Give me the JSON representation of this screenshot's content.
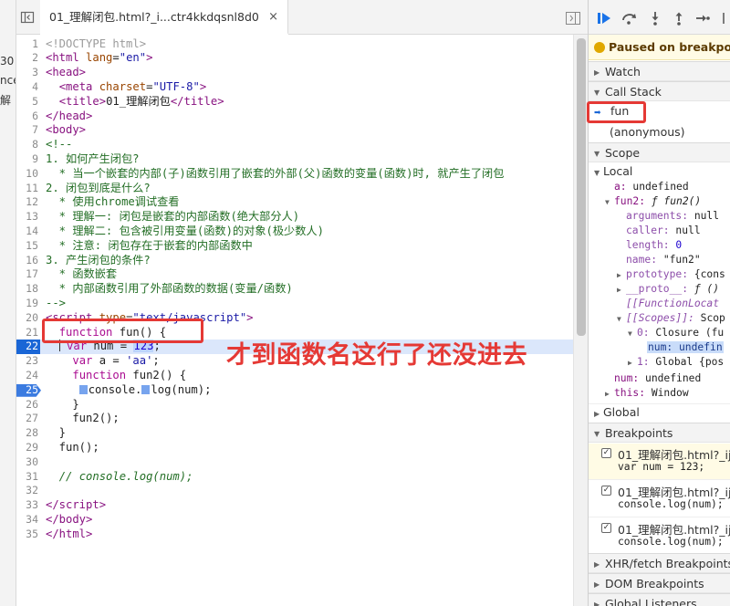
{
  "left_panel": {
    "fragments": [
      "30",
      "nce",
      "解"
    ]
  },
  "editor": {
    "tab_label": "01_理解闭包.html?_i...ctr4kkdqsnl8d0",
    "tab_close": "×",
    "annotation_text": "才到函数名这行了还没进去"
  },
  "code_lines": [
    {
      "n": "1",
      "html": "<span class='gray'>&lt;!DOCTYPE html&gt;</span>"
    },
    {
      "n": "2",
      "html": "<span class='tag'>&lt;html</span> <span class='attr'>lang</span>=<span class='str'>\"en\"</span><span class='tag'>&gt;</span>"
    },
    {
      "n": "3",
      "html": "<span class='tag'>&lt;head&gt;</span>"
    },
    {
      "n": "4",
      "html": "  <span class='tag'>&lt;meta</span> <span class='attr'>charset</span>=<span class='str'>\"UTF-8\"</span><span class='tag'>&gt;</span>"
    },
    {
      "n": "5",
      "html": "  <span class='tag'>&lt;title&gt;</span>01_理解闭包<span class='tag'>&lt;/title&gt;</span>"
    },
    {
      "n": "6",
      "html": "<span class='tag'>&lt;/head&gt;</span>"
    },
    {
      "n": "7",
      "html": "<span class='tag'>&lt;body&gt;</span>"
    },
    {
      "n": "8",
      "html": "<span class='cmt'>&lt;!--</span>"
    },
    {
      "n": "9",
      "html": "<span class='cmt'>1. 如何产生闭包?</span>"
    },
    {
      "n": "10",
      "html": "<span class='cmt'>  * 当一个嵌套的内部(子)函数引用了嵌套的外部(父)函数的变量(函数)时, 就产生了闭包</span>"
    },
    {
      "n": "11",
      "html": "<span class='cmt'>2. 闭包到底是什么?</span>"
    },
    {
      "n": "12",
      "html": "<span class='cmt'>  * 使用chrome调试查看</span>"
    },
    {
      "n": "13",
      "html": "<span class='cmt'>  * 理解一: 闭包是嵌套的内部函数(绝大部分人)</span>"
    },
    {
      "n": "14",
      "html": "<span class='cmt'>  * 理解二: 包含被引用变量(函数)的对象(极少数人)</span>"
    },
    {
      "n": "15",
      "html": "<span class='cmt'>  * 注意: 闭包存在于嵌套的内部函数中</span>"
    },
    {
      "n": "16",
      "html": "<span class='cmt'>3. 产生闭包的条件?</span>"
    },
    {
      "n": "17",
      "html": "<span class='cmt'>  * 函数嵌套</span>"
    },
    {
      "n": "18",
      "html": "<span class='cmt'>  * 内部函数引用了外部函数的数据(变量/函数)</span>"
    },
    {
      "n": "19",
      "html": "<span class='cmt'>--&gt;</span>"
    },
    {
      "n": "20",
      "html": "<span class='tag'>&lt;script</span> <span class='attr'>type</span>=<span class='str'>\"text/javascript\"</span><span class='tag'>&gt;</span>"
    },
    {
      "n": "21",
      "html": "  <span class='kw'>function</span> fun() {"
    },
    {
      "n": "22",
      "html": "  <span class='cursorbar'></span> <span class='kw'>var</span> num = <span class='num selhl'>123</span>;"
    },
    {
      "n": "23",
      "html": "    <span class='kw'>var</span> a = <span class='str'>'aa'</span>;"
    },
    {
      "n": "24",
      "html": "    <span class='kw'>function</span> fun2() {"
    },
    {
      "n": "25",
      "html": "     <span class='inline-bp'></span>console.<span class='inline-bp'></span>log(num);"
    },
    {
      "n": "26",
      "html": "    }"
    },
    {
      "n": "27",
      "html": "    fun2();"
    },
    {
      "n": "28",
      "html": "  }"
    },
    {
      "n": "29",
      "html": "  fun();"
    },
    {
      "n": "30",
      "html": ""
    },
    {
      "n": "31",
      "html": "  <span class='cmt-i'>// console.log(num);</span>"
    },
    {
      "n": "32",
      "html": ""
    },
    {
      "n": "33",
      "html": "<span class='tag'>&lt;/script&gt;</span>"
    },
    {
      "n": "34",
      "html": "<span class='tag'>&lt;/body&gt;</span>"
    },
    {
      "n": "35",
      "html": "<span class='tag'>&lt;/html&gt;</span>"
    }
  ],
  "paused_line": "22",
  "breakpoint_line": "25",
  "debugger": {
    "paused_text": "Paused on breakpoint",
    "sections": {
      "watch": "Watch",
      "call_stack": "Call Stack",
      "scope": "Scope",
      "breakpoints": "Breakpoints",
      "xhr": "XHR/fetch Breakpoints",
      "dom": "DOM Breakpoints",
      "global_listeners": "Global Listeners"
    },
    "call_stack": [
      "fun",
      "(anonymous)"
    ],
    "scope": {
      "local_label": "Local",
      "a_key": "a:",
      "a_val": "undefined",
      "fun2_key": "fun2:",
      "fun2_val": "ƒ fun2()",
      "arguments_key": "arguments:",
      "arguments_val": "null",
      "caller_key": "caller:",
      "caller_val": "null",
      "length_key": "length:",
      "length_val": "0",
      "name_key": "name:",
      "name_val": "\"fun2\"",
      "prototype_key": "prototype:",
      "prototype_val": "{cons",
      "proto_key": "__proto__:",
      "proto_val": "ƒ ()",
      "function_location": "[[FunctionLocat",
      "scopes_key": "[[Scopes]]:",
      "scopes_val": "Scop",
      "closure_key": "0:",
      "closure_val": "Closure (fu",
      "closure_num": "num: undefin",
      "global_scope_key": "1:",
      "global_scope_val": "Global {pos",
      "num_key": "num:",
      "num_val": "undefined",
      "this_key": "this:",
      "this_val": "Window",
      "global_label": "Global"
    },
    "breakpoints": [
      {
        "file": "01_理解闭包.html?_ij",
        "code": "var num = 123;",
        "active": true
      },
      {
        "file": "01_理解闭包.html?_ij",
        "code": "console.log(num);",
        "active": false
      },
      {
        "file": "01_理解闭包.html?_ij",
        "code": "console.log(num);",
        "active": false
      }
    ]
  }
}
